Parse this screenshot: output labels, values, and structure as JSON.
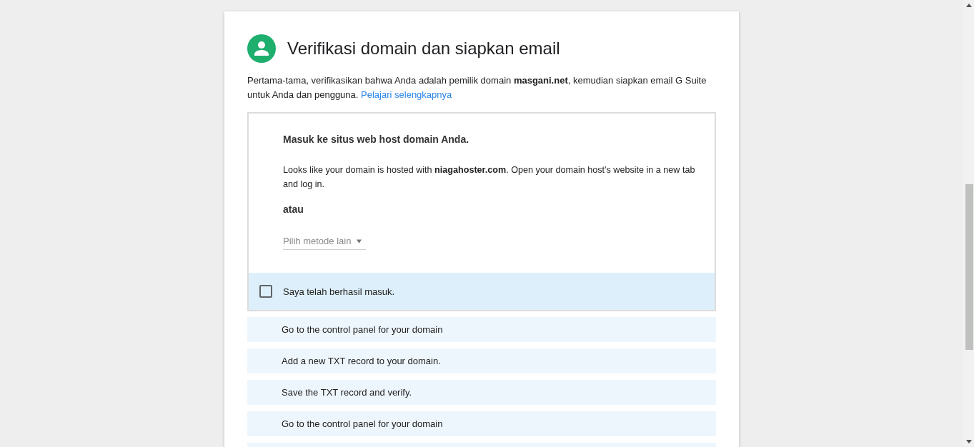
{
  "header": {
    "title": "Verifikasi domain dan siapkan email"
  },
  "intro": {
    "text": "Pertama-tama, verifikasikan bahwa Anda adalah pemilik domain **masgani.net**, kemudian siapkan email G Suite untuk Anda dan pengguna.",
    "link": "Pelajari selengkapnya"
  },
  "step": {
    "title": "Masuk ke situs web host domain Anda.",
    "text": "Looks like your domain is hosted with **niagahoster.com**. Open your domain host's website in a new tab and log in.",
    "separator": "atau",
    "method_select": {
      "placeholder": "Pilih metode lain"
    },
    "confirm": {
      "label": "Saya telah berhasil masuk.",
      "checked": false
    }
  },
  "next_steps": [
    {
      "label": "Go to the control panel for your domain"
    },
    {
      "label": "Add a new TXT record to your domain."
    },
    {
      "label": "Save the TXT record and verify."
    },
    {
      "label": "Go to the control panel for your domain"
    }
  ]
}
